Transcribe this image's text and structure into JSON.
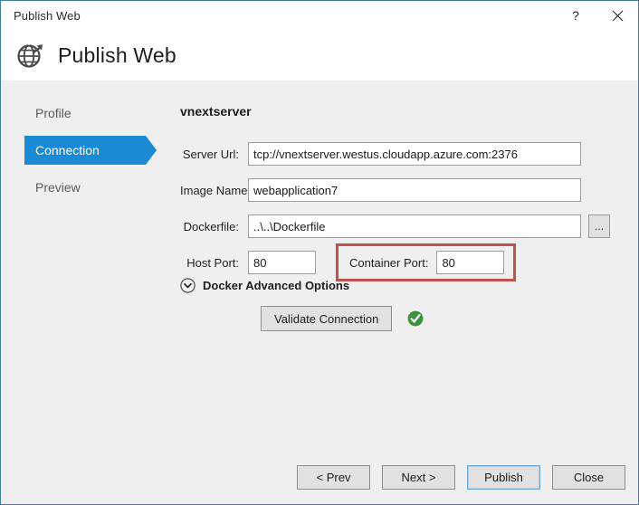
{
  "window": {
    "titlebar_text": "Publish Web",
    "help_icon": "question-mark-icon",
    "close_icon": "close-icon",
    "border_color": "#3c7fa0",
    "background": "#efefef"
  },
  "header": {
    "icon": "globe-publish-icon",
    "title": "Publish Web"
  },
  "sidebar": {
    "items": [
      {
        "label": "Profile",
        "selected": false
      },
      {
        "label": "Connection",
        "selected": true
      },
      {
        "label": "Preview",
        "selected": false
      }
    ],
    "selected_color": "#1a8ad4"
  },
  "main": {
    "pane_title": "vnextserver",
    "fields": {
      "server_url": {
        "label": "Server Url:",
        "value": "tcp://vnextserver.westus.cloudapp.azure.com:2376"
      },
      "image_name": {
        "label": "Image Name:",
        "value": "webapplication7"
      },
      "dockerfile": {
        "label": "Dockerfile:",
        "value": "..\\..\\Dockerfile",
        "browse_label": "..."
      },
      "host_port": {
        "label": "Host Port:",
        "value": "80"
      },
      "container_port": {
        "label": "Container Port:",
        "value": "80",
        "highlight_color": "#c0504d"
      }
    },
    "advanced": {
      "icon": "chevron-down-circle-icon",
      "label": "Docker Advanced Options"
    },
    "validate": {
      "button_label": "Validate Connection",
      "status_icon": "green-check-circle-icon",
      "status_color": "#3d9140"
    }
  },
  "footer": {
    "buttons": [
      {
        "label": "< Prev",
        "default": false
      },
      {
        "label": "Next >",
        "default": false
      },
      {
        "label": "Publish",
        "default": true
      },
      {
        "label": "Close",
        "default": false
      }
    ]
  }
}
